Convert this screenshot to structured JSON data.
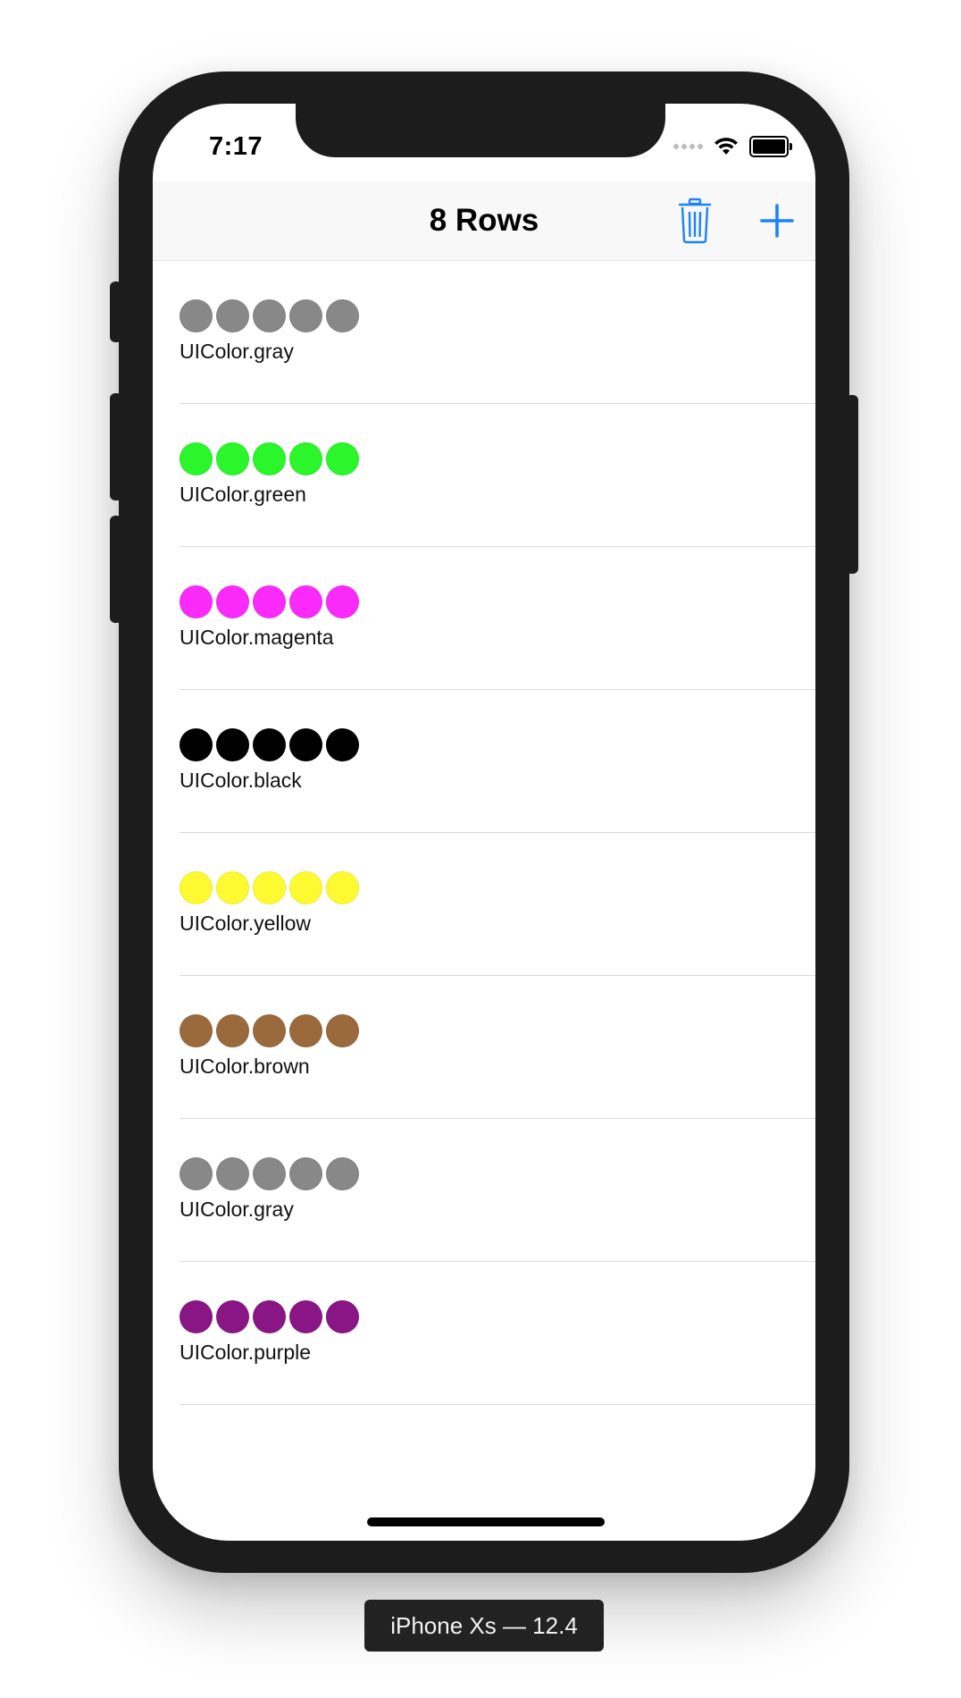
{
  "status_bar": {
    "time": "7:17"
  },
  "navbar": {
    "title": "8 Rows",
    "trash_icon": "trash-icon",
    "add_icon": "plus-icon",
    "tint_color": "#1a82fb"
  },
  "rows": [
    {
      "label": "UIColor.gray",
      "color": "#888888"
    },
    {
      "label": "UIColor.green",
      "color": "#2bf52b"
    },
    {
      "label": "UIColor.magenta",
      "color": "#fa2bfa"
    },
    {
      "label": "UIColor.black",
      "color": "#000000"
    },
    {
      "label": "UIColor.yellow",
      "color": "#fdfa32"
    },
    {
      "label": "UIColor.brown",
      "color": "#9a6a3c"
    },
    {
      "label": "UIColor.gray",
      "color": "#888888"
    },
    {
      "label": "UIColor.purple",
      "color": "#8a1685"
    }
  ],
  "device_label": "iPhone Xs — 12.4"
}
